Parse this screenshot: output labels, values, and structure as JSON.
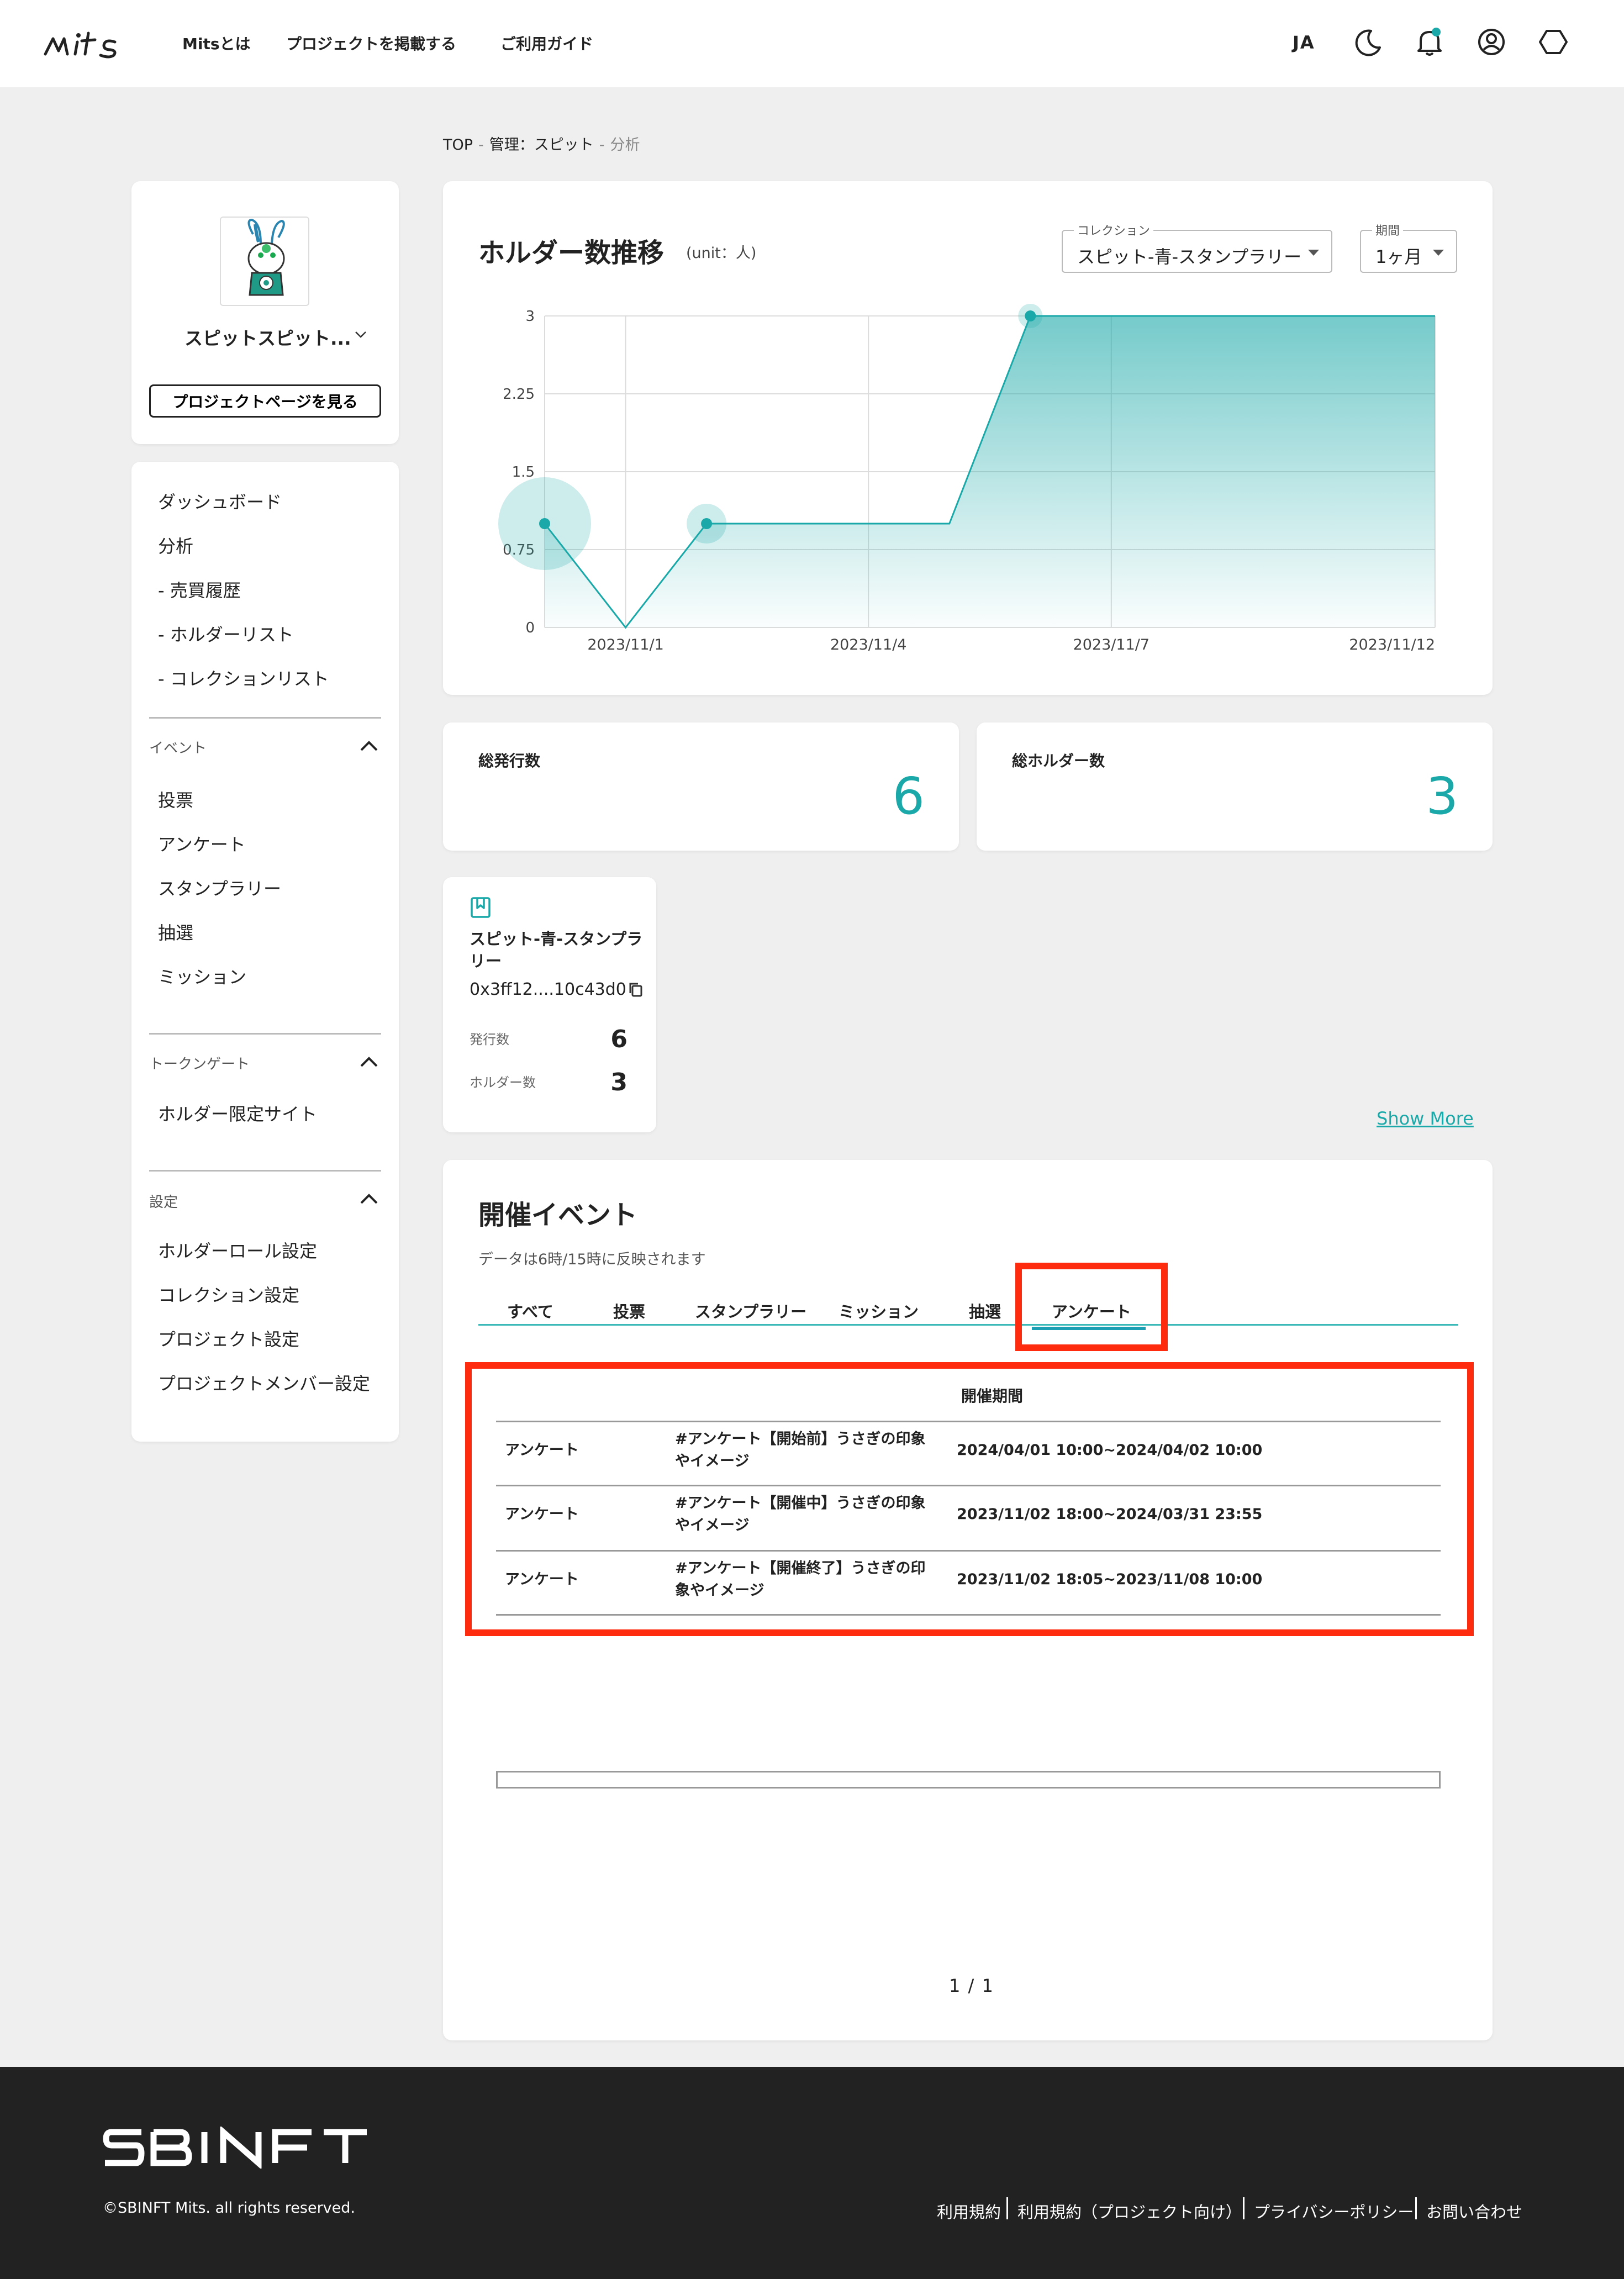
{
  "header": {
    "logo_text": "Mits",
    "nav": [
      "Mitsとは",
      "プロジェクトを掲載する",
      "ご利用ガイド"
    ],
    "language": "JA",
    "icons": [
      "moon-icon",
      "bell-icon",
      "account-icon",
      "settings-hexagon-icon"
    ],
    "accent_color": "#1aa8a8"
  },
  "breadcrumb": {
    "top": "TOP",
    "project": "管理：スピット",
    "current": "分析",
    "sep": "-"
  },
  "profile": {
    "name": "スピットスピット...",
    "view_button": "プロジェクトページを見る"
  },
  "menu": {
    "main": [
      "ダッシュボード",
      "分析",
      "- 売買履歴",
      "- ホルダーリスト",
      "- コレクションリスト"
    ],
    "event_section": "イベント",
    "event_items": [
      "投票",
      "アンケート",
      "スタンプラリー",
      "抽選",
      "ミッション"
    ],
    "token_section": "トークンゲート",
    "token_items": [
      "ホルダー限定サイト"
    ],
    "settings_section": "設定",
    "settings_items": [
      "ホルダーロール設定",
      "コレクション設定",
      "プロジェクト設定",
      "プロジェクトメンバー設定"
    ]
  },
  "chart_card": {
    "title": "ホルダー数推移",
    "unit": "(unit：人)",
    "collection_label": "コレクション",
    "collection_value": "スピット-青-スタンプラリー",
    "period_label": "期間",
    "period_value": "1ヶ月"
  },
  "chart_data": {
    "type": "area",
    "title": "ホルダー数推移",
    "x": [
      1,
      2,
      3,
      4,
      5,
      6,
      7,
      8,
      9,
      10,
      11,
      12
    ],
    "values": [
      1,
      0,
      1,
      1,
      1,
      1,
      3,
      3,
      3,
      3,
      3,
      3
    ],
    "x_tick_labels": [
      "2023/11/1",
      "2023/11/4",
      "2023/11/7",
      "2023/11/12"
    ],
    "x_tick_positions": [
      2,
      5,
      8,
      12
    ],
    "y_ticks": [
      "0",
      "0.75",
      "1.5",
      "2.25",
      "3"
    ],
    "ylim": [
      0,
      3
    ],
    "xlim": [
      1,
      12
    ],
    "grid": true,
    "color": "#1aa8a8"
  },
  "stats": {
    "total_issued_label": "総発行数",
    "total_issued": "6",
    "total_holders_label": "総ホルダー数",
    "total_holders": "3"
  },
  "collection": {
    "name": "スピット-青-スタンプラリー",
    "address": "0x3ff12....10c43d0",
    "issued_label": "発行数",
    "issued": "6",
    "holders_label": "ホルダー数",
    "holders": "3"
  },
  "show_more": "Show More",
  "events": {
    "title": "開催イベント",
    "subtitle": "データは6時/15時に反映されます",
    "tabs": [
      "すべて",
      "投票",
      "スタンプラリー",
      "ミッション",
      "抽選",
      "アンケート"
    ],
    "active_tab": "アンケート",
    "period_header": "開催期間",
    "rows": [
      {
        "type": "アンケート",
        "name_l1": "#アンケート【開始前】うさぎの印象",
        "name_l2": "やイメージ",
        "period": "2024/04/01 10:00~2024/04/02 10:00"
      },
      {
        "type": "アンケート",
        "name_l1": "#アンケート【開催中】うさぎの印象",
        "name_l2": "やイメージ",
        "period": "2023/11/02 18:00~2024/03/31 23:55"
      },
      {
        "type": "アンケート",
        "name_l1": "#アンケート【開催終了】うさぎの印",
        "name_l2": "象やイメージ",
        "period": "2023/11/02 18:05~2023/11/08 10:00"
      }
    ],
    "pager": "1 / 1",
    "highlight_color": "#ff2b0e"
  },
  "footer": {
    "logo_text": "SBINFT",
    "copyright": "©SBINFT Mits. all rights reserved.",
    "links": [
      "利用規約",
      "利用規約（プロジェクト向け）",
      "プライバシーポリシー",
      "お問い合わせ"
    ]
  }
}
